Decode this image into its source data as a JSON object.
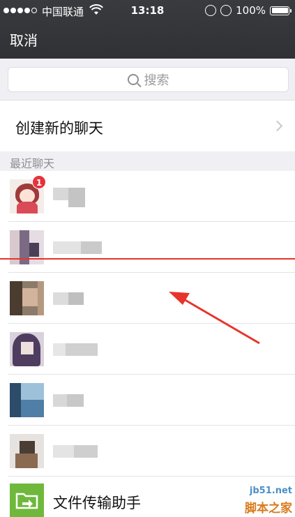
{
  "status_bar": {
    "carrier": "中国联通",
    "time": "13:18",
    "battery": "100%"
  },
  "nav": {
    "cancel_label": "取消"
  },
  "search": {
    "placeholder": "搜索"
  },
  "create_chat": {
    "label": "创建新的聊天"
  },
  "recent_section": {
    "title": "最近聊天"
  },
  "chats": [
    {
      "badge": "1",
      "name_redacted": true
    },
    {
      "name_redacted": true
    },
    {
      "name_redacted": true
    },
    {
      "name_redacted": true
    },
    {
      "name_redacted": true
    },
    {
      "name_redacted": true
    },
    {
      "name": "文件传输助手",
      "icon": "folder-arrow-icon"
    }
  ],
  "watermark": {
    "url": "jb51.net",
    "name": "脚本之家"
  },
  "colors": {
    "nav_bg": "#333438",
    "group_bg": "#efeff4",
    "badge": "#e5333b",
    "annotation_red": "#e7342b",
    "file_helper_green": "#6fb83c"
  }
}
